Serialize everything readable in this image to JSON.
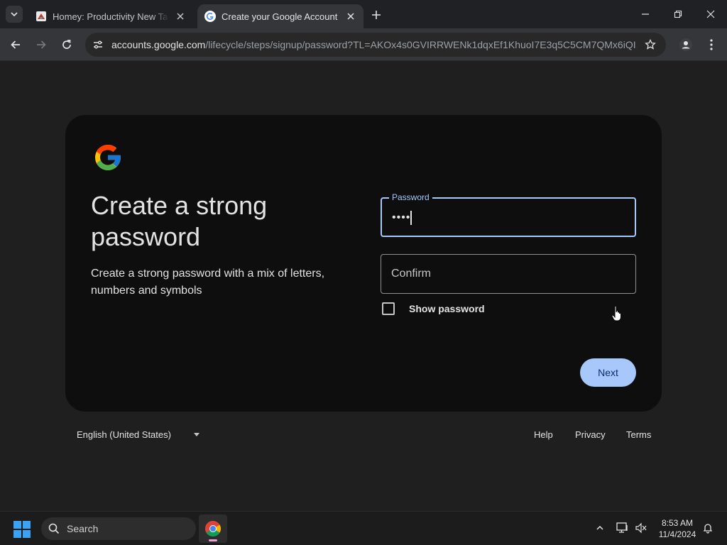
{
  "browser": {
    "tabs": [
      {
        "title": "Homey: Productivity New Tab -",
        "active": false
      },
      {
        "title": "Create your Google Account",
        "active": true
      }
    ],
    "url_host": "accounts.google.com",
    "url_path": "/lifecycle/steps/signup/password?TL=AKOx4s0GVIRRWENk1dqxEf1KhuoI7E3q5C5CM7QMx6iQI..."
  },
  "signup": {
    "heading": "Create a strong password",
    "subtext": "Create a strong password with a mix of letters, numbers and symbols",
    "password_label": "Password",
    "password_value": "••••",
    "confirm_placeholder": "Confirm",
    "show_password_label": "Show password",
    "show_password_checked": false,
    "next_label": "Next"
  },
  "footer": {
    "language": "English (United States)",
    "links": [
      "Help",
      "Privacy",
      "Terms"
    ]
  },
  "taskbar": {
    "search_label": "Search",
    "time": "8:53 AM",
    "date": "11/4/2024"
  },
  "colors": {
    "accent": "#a8c7fa",
    "button_text": "#062e6f",
    "card_bg": "#0e0e0e",
    "page_bg": "#1f1f1f"
  }
}
